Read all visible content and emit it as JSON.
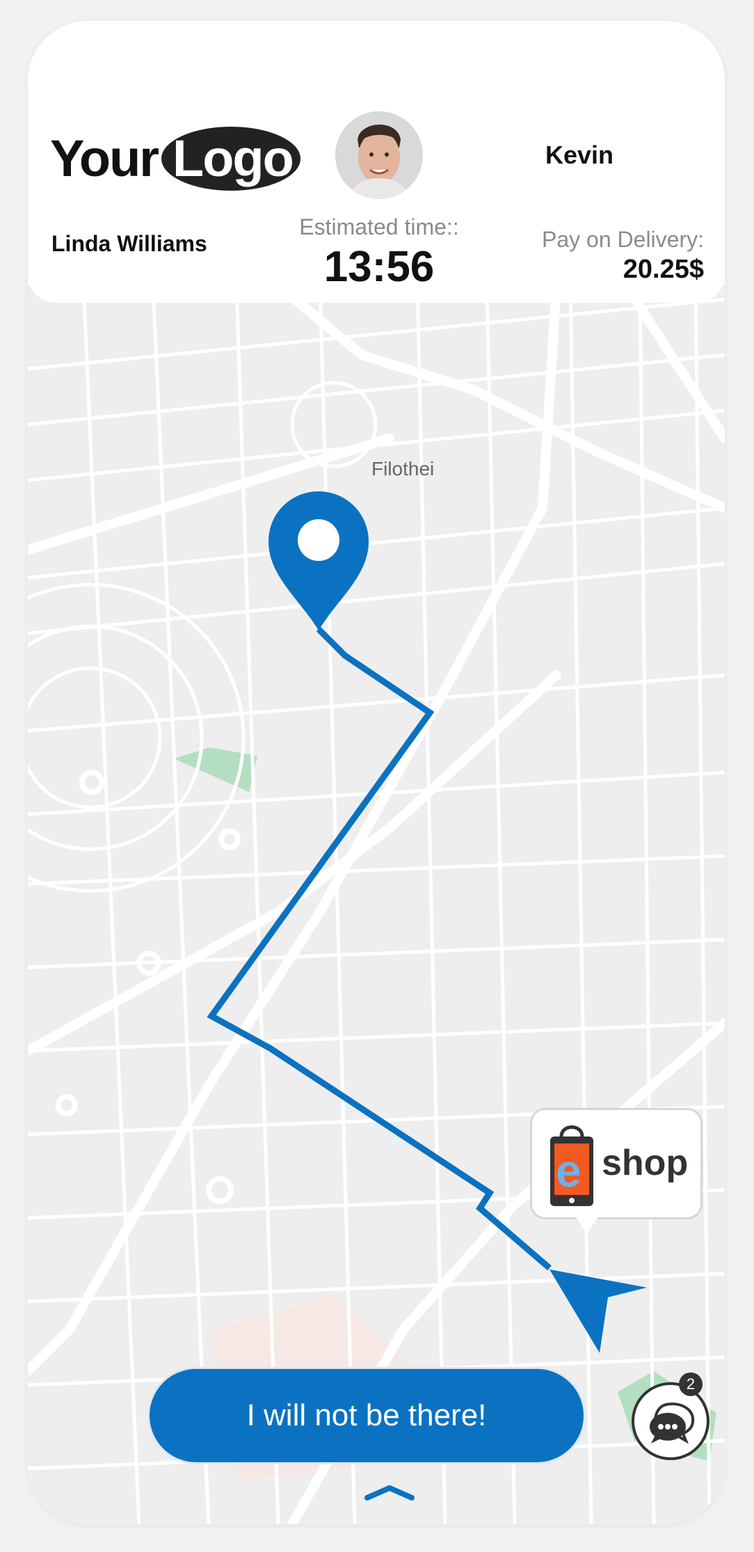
{
  "app": {
    "logo": {
      "word1": "Your",
      "word2": "Logo"
    },
    "driver_name": "Kevin",
    "customer_name": "Linda Williams",
    "eta": {
      "label": "Estimated time::",
      "value": "13:56"
    },
    "payment": {
      "label": "Pay on Delivery:",
      "amount": "20.25$"
    }
  },
  "map": {
    "place_label": "Filothei",
    "route_color": "#0b72c1",
    "park_color": "#b3dfc0"
  },
  "eshop_badge": {
    "text": "shop"
  },
  "actions": {
    "not_there_label": "I will not be there!"
  },
  "chat": {
    "unread_count": "2"
  },
  "colors": {
    "accent": "#0b72c1",
    "dark": "#333333",
    "muted": "#8a8a8a"
  }
}
